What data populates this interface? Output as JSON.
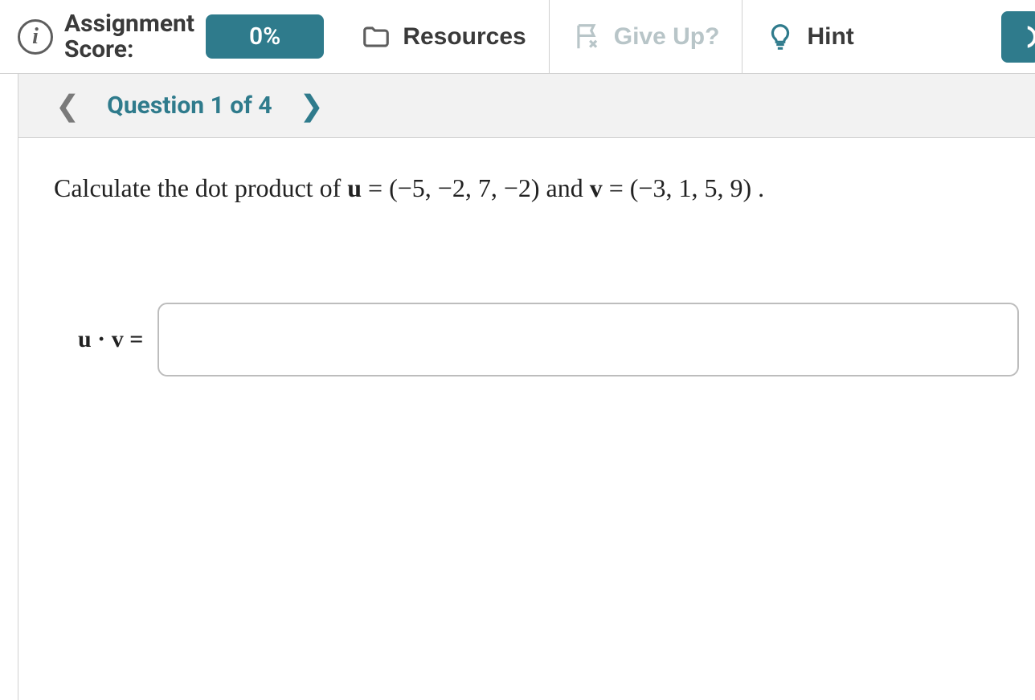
{
  "toolbar": {
    "score_label_line1": "Assignment",
    "score_label_line2": "Score:",
    "score_value": "0%",
    "resources_label": "Resources",
    "giveup_label": "Give Up?",
    "hint_label": "Hint"
  },
  "nav": {
    "title": "Question 1 of 4"
  },
  "question": {
    "prompt_prefix": "Calculate the dot product of ",
    "u_label": "u",
    "equals1": " = (−5, −2, 7, −2) and ",
    "v_label": "v",
    "equals2": " = (−3, 1, 5, 9) .",
    "answer_label": "u · v =",
    "answer_value": ""
  }
}
